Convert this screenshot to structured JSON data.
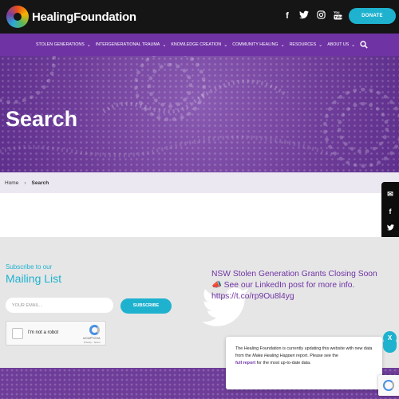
{
  "header": {
    "logo_text": "HealingFoundation",
    "social": [
      {
        "name": "facebook-icon",
        "glyph": "f"
      },
      {
        "name": "twitter-icon",
        "glyph": "t"
      },
      {
        "name": "instagram-icon",
        "glyph": "◎"
      },
      {
        "name": "youtube-icon",
        "glyph": "▶"
      }
    ],
    "donate_label": "DONATE"
  },
  "nav": {
    "items": [
      {
        "label": "STOLEN GENERATIONS",
        "dropdown": true
      },
      {
        "label": "INTERGENERATIONAL TRAUMA",
        "dropdown": true
      },
      {
        "label": "KNOWLEDGE CREATION",
        "dropdown": true
      },
      {
        "label": "COMMUNITY HEALING",
        "dropdown": true
      },
      {
        "label": "RESOURCES",
        "dropdown": true
      },
      {
        "label": "ABOUT US",
        "dropdown": true
      }
    ],
    "search_icon": "search-icon"
  },
  "hero": {
    "title": "Search"
  },
  "breadcrumb": {
    "home": "Home",
    "current": "Search"
  },
  "share": {
    "icons": [
      "email-icon",
      "facebook-icon",
      "twitter-icon"
    ]
  },
  "footer": {
    "subscribe_small": "Subscribe to our",
    "subscribe_big": "Mailing List",
    "email_placeholder": "YOUR EMAIL...",
    "subscribe_button": "SUBSCRIBE",
    "recaptcha_label": "I'm not a robot",
    "recaptcha_brand": "reCAPTCHA",
    "recaptcha_terms": "Privacy - Terms",
    "tweet_lines": [
      "NSW Stolen Generation Grants Closing Soon",
      "📣 See our LinkedIn post for more info.",
      "https://t.co/rp9Ou8l4yg"
    ]
  },
  "notice": {
    "text_1": "The Healing Foundation is currently updating this website with new data from the ",
    "report_name": "Make Healing Happen",
    "text_2": " report. Please see the",
    "link": "full report",
    "text_3": " for the most up-to-date data.",
    "close_label": "X"
  },
  "colors": {
    "accent": "#1fb2cf",
    "brand_purple": "#6f33a4",
    "header_bg": "#151515"
  }
}
